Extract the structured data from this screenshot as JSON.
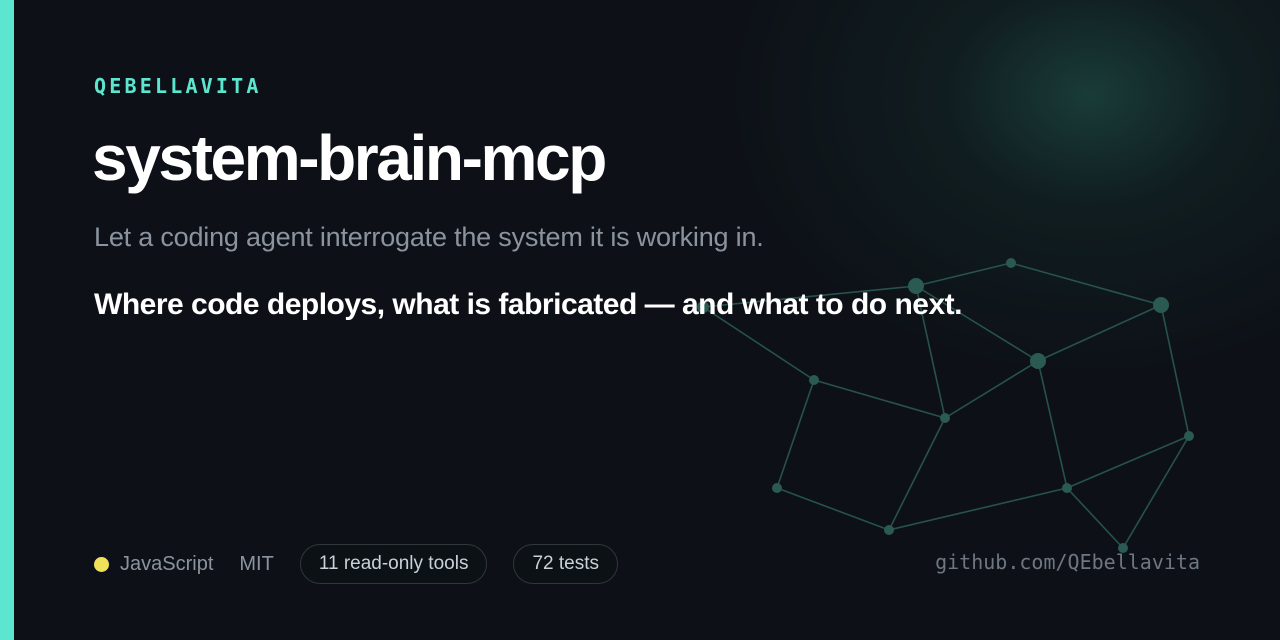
{
  "card": {
    "owner": "QEBELLAVITA",
    "repo_name": "system-brain-mcp",
    "tagline": "Let a coding agent interrogate the system it is working in.",
    "statement": "Where code deploys, what is fabricated — and what to do next."
  },
  "footer": {
    "language": "JavaScript",
    "language_color": "#f1e05a",
    "license": "MIT",
    "tools_badge": "11 read-only tools",
    "tests_badge": "72 tests",
    "link": "github.com/QEbellavita"
  },
  "colors": {
    "background": "#0d1117",
    "accent": "#5ce6d0",
    "network": "#2a5a52"
  },
  "icons": [
    "network-graph-icon",
    "language-dot-icon"
  ]
}
